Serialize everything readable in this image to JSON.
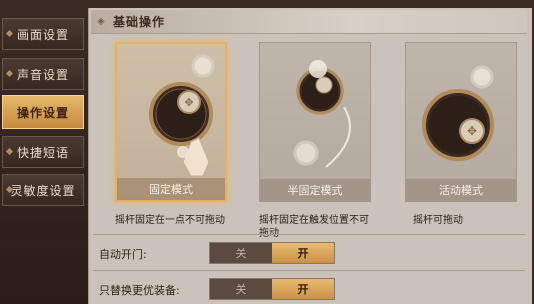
{
  "sidebar": {
    "items": [
      {
        "label": "画面设置",
        "active": false
      },
      {
        "label": "声音设置",
        "active": false
      },
      {
        "label": "操作设置",
        "active": true
      },
      {
        "label": "快捷短语",
        "active": false
      },
      {
        "label": "灵敏度设置",
        "active": false
      }
    ]
  },
  "section": {
    "title": "基础操作",
    "icon": "ornament-icon"
  },
  "modes": [
    {
      "label": "固定模式",
      "desc": "摇杆固定在一点不可拖动",
      "selected": true
    },
    {
      "label": "半固定模式",
      "desc": "摇杆固定在触发位置不可拖动",
      "selected": false
    },
    {
      "label": "活动模式",
      "desc": "摇杆可拖动",
      "selected": false
    }
  ],
  "settings": {
    "auto_door": {
      "label": "自动开门:",
      "off": "关",
      "on": "开",
      "value": "开"
    },
    "replace_better": {
      "label": "只替换更优装备:",
      "off": "关",
      "on": "开",
      "value": "开"
    }
  },
  "colors": {
    "accent": "#e7b15d",
    "panel": "#cbc3bb",
    "sidebar": "#2a1d18"
  }
}
